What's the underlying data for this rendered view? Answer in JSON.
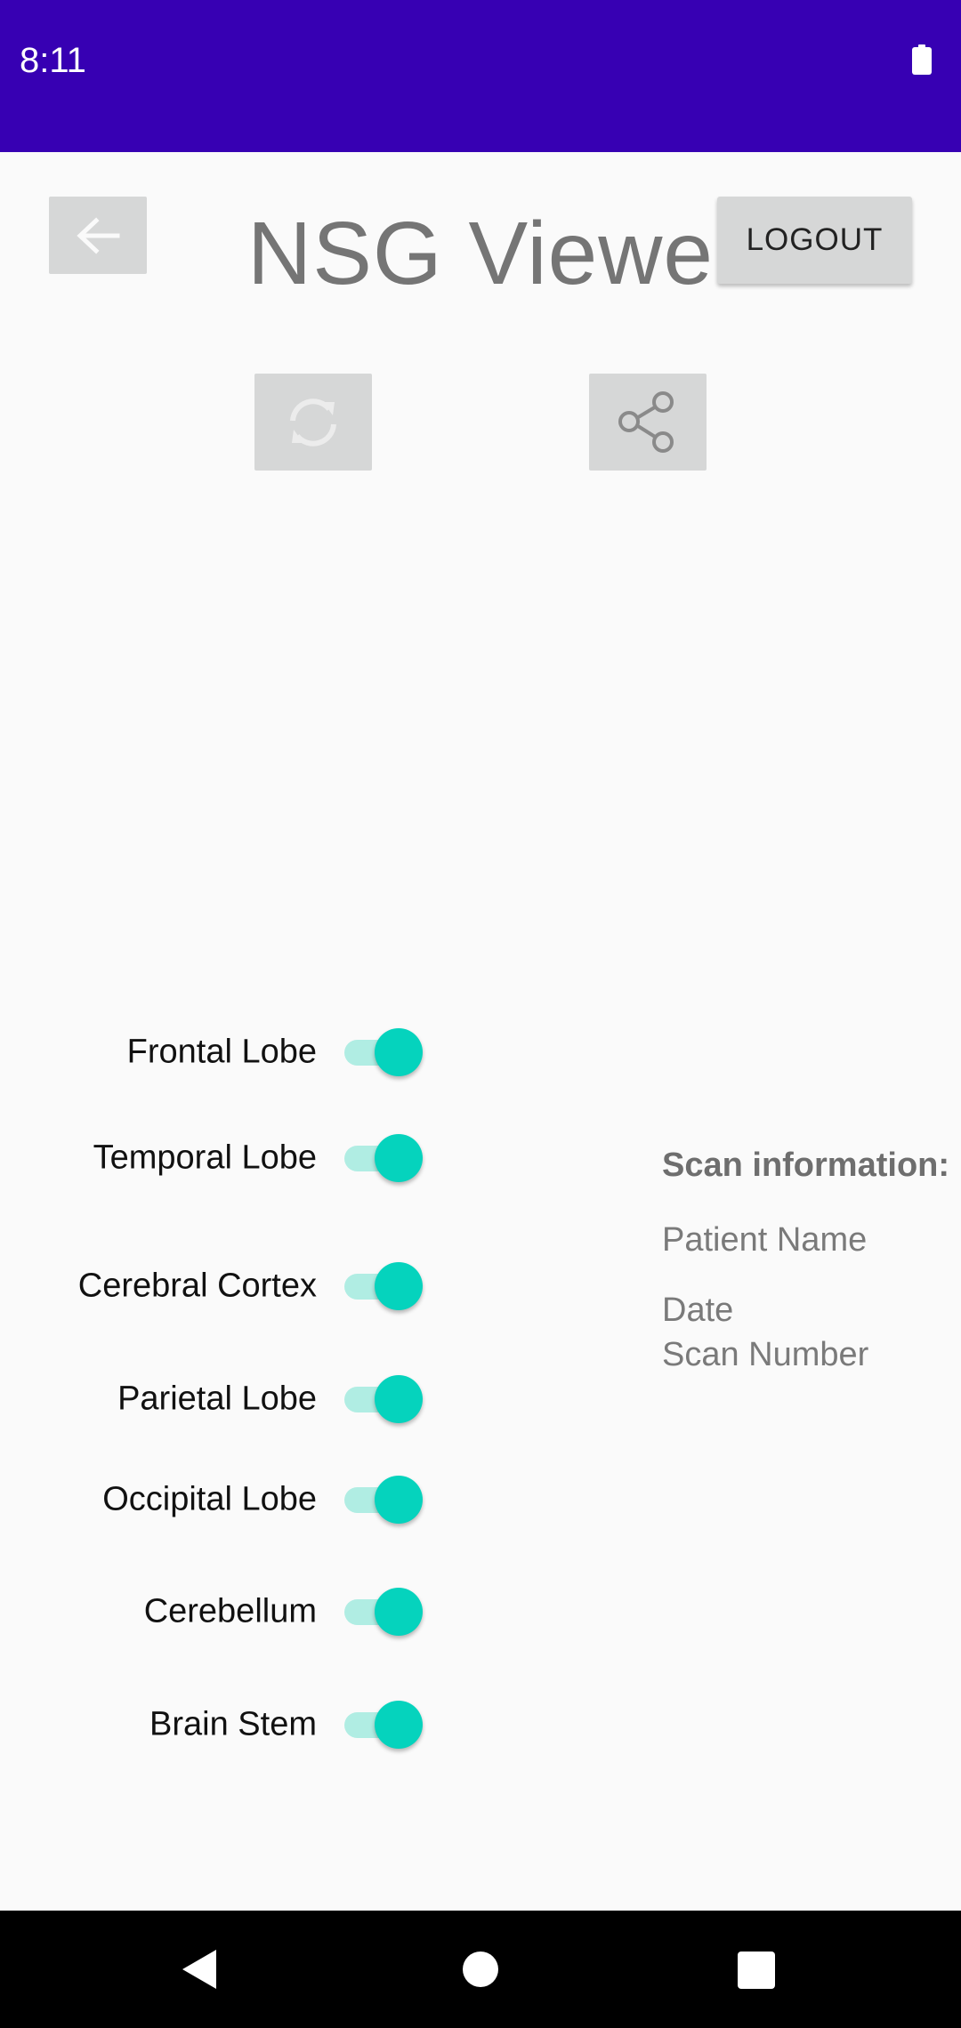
{
  "status_bar": {
    "time": "8:11"
  },
  "header": {
    "title": "NSG Viewer",
    "logout_label": "LOGOUT"
  },
  "toolbar": {
    "back_icon": "arrow-left-icon",
    "refresh_icon": "refresh-icon",
    "share_icon": "share-icon"
  },
  "toggles": [
    {
      "label": "Frontal Lobe",
      "checked": true
    },
    {
      "label": "Temporal Lobe",
      "checked": true
    },
    {
      "label": "Cerebral Cortex",
      "checked": true
    },
    {
      "label": "Parietal Lobe",
      "checked": true
    },
    {
      "label": "Occipital Lobe",
      "checked": true
    },
    {
      "label": "Cerebellum",
      "checked": true
    },
    {
      "label": "Brain Stem",
      "checked": true
    }
  ],
  "scan_info": {
    "heading": "Scan information:",
    "patient_name": "Patient Name",
    "date": "Date",
    "scan_number": "Scan Number"
  },
  "colors": {
    "status_bar": "#3700b3",
    "switch_thumb": "#05d3bd",
    "switch_track": "#b0ede3",
    "button_bg": "#d6d7d7"
  }
}
